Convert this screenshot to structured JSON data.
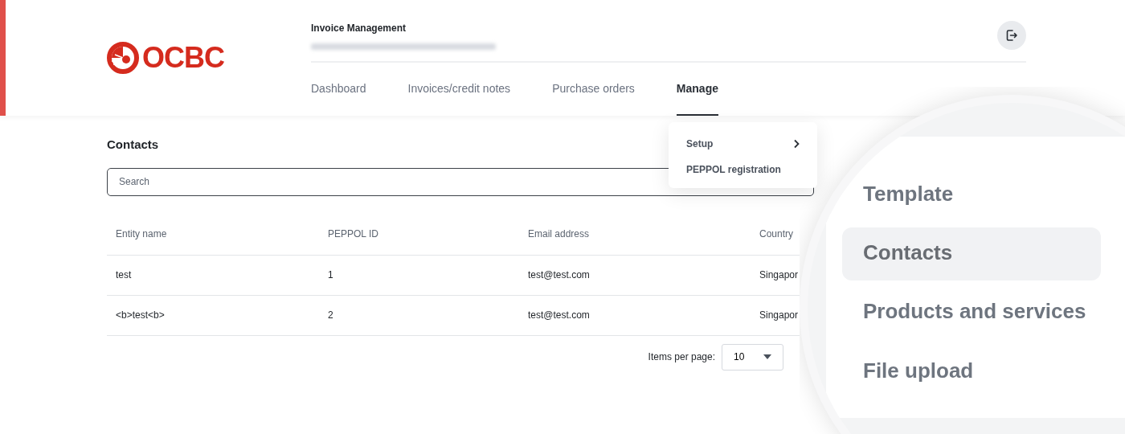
{
  "logo": {
    "text": "OCBC"
  },
  "header": {
    "title": "Invoice Management"
  },
  "nav": {
    "tabs": [
      {
        "label": "Dashboard",
        "selected": false
      },
      {
        "label": "Invoices/credit notes",
        "selected": false
      },
      {
        "label": "Purchase orders",
        "selected": false
      },
      {
        "label": "Manage",
        "selected": true
      }
    ]
  },
  "manage_menu": {
    "items": [
      {
        "label": "Setup",
        "kind": "submenu"
      },
      {
        "label": "PEPPOL registration",
        "kind": "link"
      }
    ]
  },
  "page_title": "Contacts",
  "search": {
    "placeholder": "Search"
  },
  "table": {
    "columns": [
      "Entity name",
      "PEPPOL ID",
      "Email address",
      "Country"
    ],
    "rows": [
      [
        "test",
        "1",
        "test@test.com",
        "Singapor"
      ],
      [
        "<b>test<b>",
        "2",
        "test@test.com",
        "Singapor"
      ]
    ]
  },
  "pagination": {
    "label": "Items per page:",
    "value": "10"
  },
  "magnifier": {
    "items": [
      {
        "label": "Template",
        "selected": false
      },
      {
        "label": "Contacts",
        "selected": true
      },
      {
        "label": "Products and services",
        "selected": false
      },
      {
        "label": "File upload",
        "selected": false
      }
    ]
  }
}
